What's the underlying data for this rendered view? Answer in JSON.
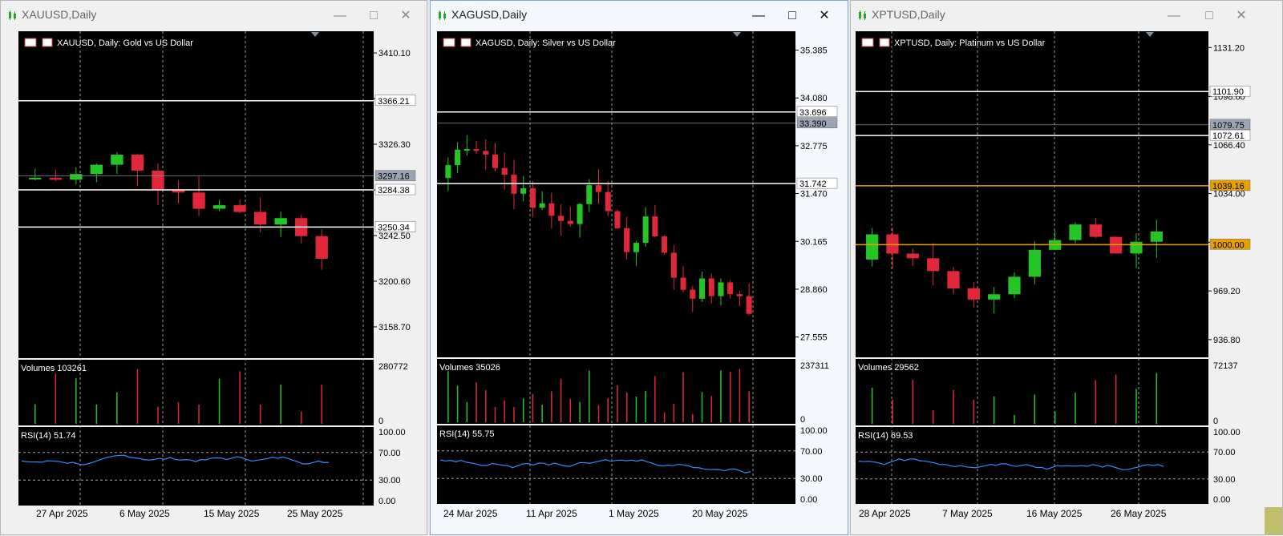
{
  "windows": [
    {
      "title": "XAUUSD,Daily",
      "header": "XAUUSD, Daily:  Gold vs US Dollar",
      "active": false,
      "price_ticks": [
        "3410.10",
        "3368.21",
        "3326.30",
        "3284.38",
        "3242.50",
        "3200.60",
        "3158.70"
      ],
      "hlines": [
        {
          "label": "3366.21",
          "y": 3366.21
        },
        {
          "label": "3297.16",
          "y": 3297.16,
          "highlight": true
        },
        {
          "label": "3284.38",
          "y": 3284.38
        },
        {
          "label": "3250.34",
          "y": 3250.34
        }
      ],
      "volume_label": "Volumes 103261",
      "volume_ticks": [
        "280772",
        "0"
      ],
      "rsi_label": "RSI(14) 51.74",
      "rsi_ticks": [
        "100.00",
        "70.00",
        "30.00",
        "0.00"
      ],
      "date_ticks": [
        "27 Apr 2025",
        "6 May 2025",
        "15 May 2025",
        "25 May 2025"
      ]
    },
    {
      "title": "XAGUSD,Daily",
      "header": "XAGUSD, Daily:  Silver vs US Dollar",
      "active": true,
      "price_ticks": [
        "35.385",
        "34.080",
        "32.775",
        "31.470",
        "30.165",
        "28.860",
        "27.555"
      ],
      "hlines": [
        {
          "label": "33.696",
          "y": 33.696
        },
        {
          "label": "33.390",
          "y": 33.39,
          "highlight": true
        },
        {
          "label": "31.742",
          "y": 31.742
        }
      ],
      "volume_label": "Volumes 35026",
      "volume_ticks": [
        "237311",
        "0"
      ],
      "rsi_label": "RSI(14) 55.75",
      "rsi_ticks": [
        "100.00",
        "70.00",
        "30.00",
        "0.00"
      ],
      "date_ticks": [
        "24 Mar 2025",
        "11 Apr 2025",
        "1 May 2025",
        "20 May 2025"
      ]
    },
    {
      "title": "XPTUSD,Daily",
      "header": "XPTUSD, Daily:  Platinum vs US Dollar",
      "active": false,
      "price_ticks": [
        "1131.20",
        "1098.60",
        "1066.40",
        "1034.00",
        "1001.60",
        "969.20",
        "936.80"
      ],
      "hlines": [
        {
          "label": "1101.90",
          "y": 1101.9
        },
        {
          "label": "1079.75",
          "y": 1079.75,
          "highlight": true
        },
        {
          "label": "1072.61",
          "y": 1072.61
        },
        {
          "label": "1039.16",
          "y": 1039.16,
          "orange": true
        },
        {
          "label": "1000.00",
          "y": 1000.0,
          "orange": true
        }
      ],
      "volume_label": "Volumes 29562",
      "volume_ticks": [
        "72137",
        "0"
      ],
      "rsi_label": "RSI(14) 69.53",
      "rsi_ticks": [
        "100.00",
        "70.00",
        "30.00",
        "0.00"
      ],
      "date_ticks": [
        "28 Apr 2025",
        "7 May 2025",
        "16 May 2025",
        "26 May 2025"
      ]
    }
  ],
  "colors": {
    "bull": "#26c526",
    "bear": "#e0283a",
    "rsi": "#2f8cff",
    "ma_fast": "#e8e000",
    "ma_mid": "#2f8cff",
    "ma_slow": "#e0283a",
    "trend": "#e8a000",
    "grid": "#c0c0c0",
    "bg": "#000000"
  },
  "icons": {
    "chart": "candlestick-icon",
    "minimize": "minimize-icon",
    "maximize": "maximize-icon",
    "close": "close-icon"
  }
}
